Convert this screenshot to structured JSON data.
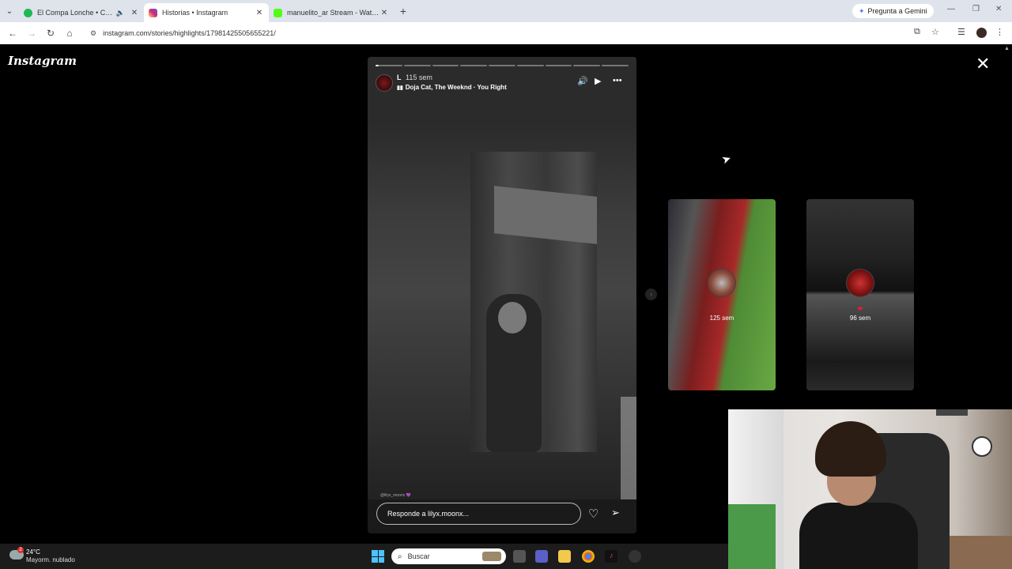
{
  "browser": {
    "tabs": [
      {
        "title": "El Compa Lonche • Código",
        "favicon_color": "#1db954",
        "muted_icon": "speaker-icon",
        "active": false
      },
      {
        "title": "Historias • Instagram",
        "favicon_color": "#d6249f",
        "active": true
      },
      {
        "title": "manuelito_ar Stream - Watch Li",
        "favicon_color": "#53fc18",
        "active": false
      }
    ],
    "gemini_label": "Pregunta a Gemini",
    "url": "instagram.com/stories/highlights/17981425505655221/"
  },
  "instagram": {
    "logo": "Instagram",
    "story": {
      "username": "L",
      "time": "115 sem",
      "music": "Doja Cat, The Weeknd · You Right",
      "watermark": "@lilyx_moonx 💜",
      "reply_placeholder": "Responde a lilyx.moonx...",
      "progress_total": 9,
      "progress_current": 1
    },
    "highlights": [
      {
        "time": "125 sem"
      },
      {
        "heart": "❤",
        "time": "96 sem"
      }
    ]
  },
  "taskbar": {
    "temperature": "24°C",
    "condition": "Mayorm. nublado",
    "search_label": "Buscar",
    "weather_badge": "2"
  }
}
